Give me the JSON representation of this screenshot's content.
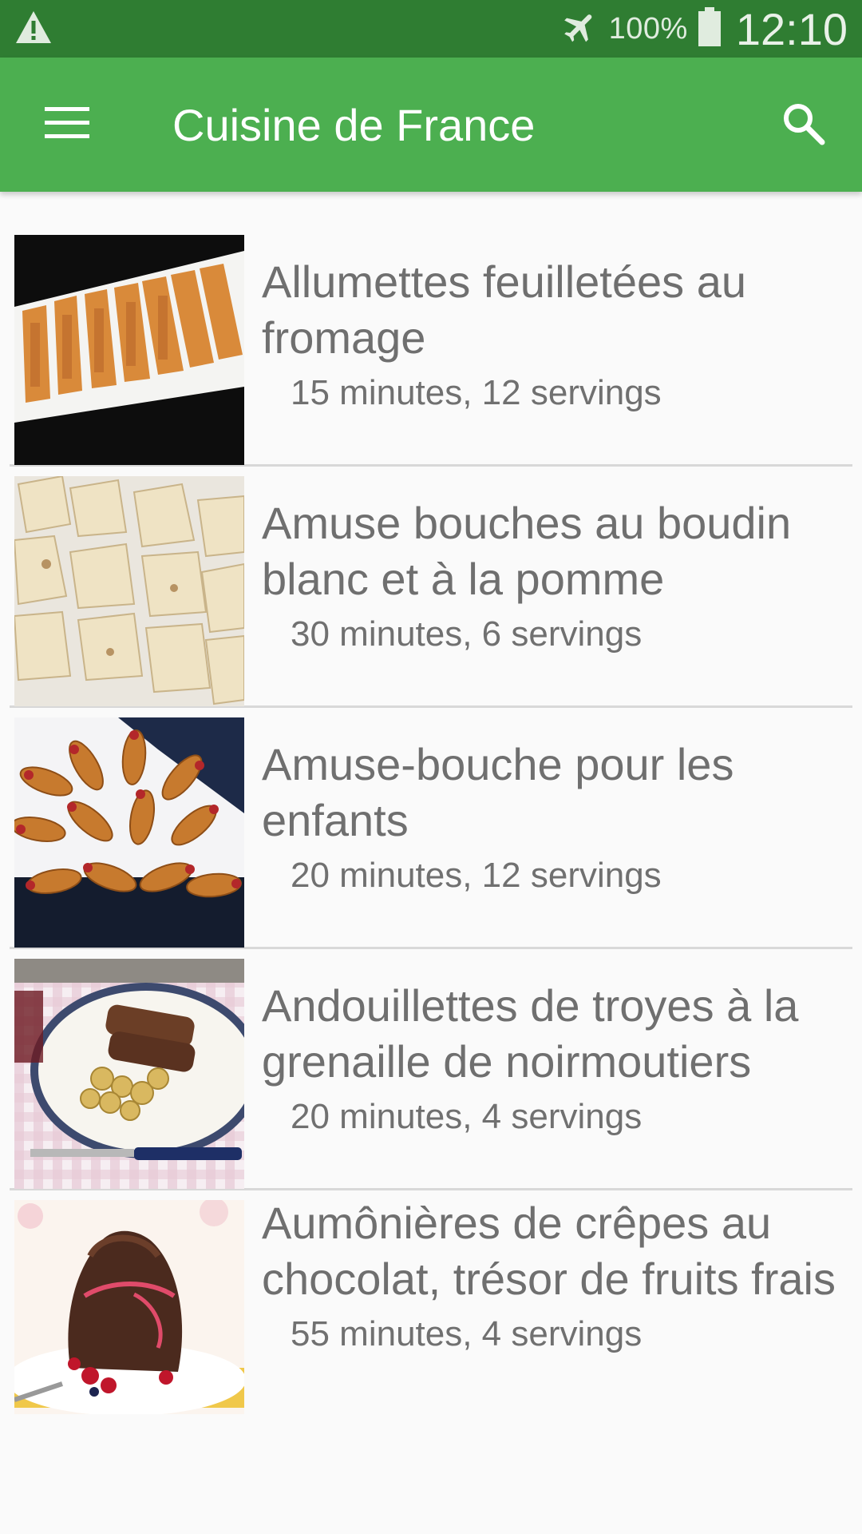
{
  "status_bar": {
    "battery": "100%",
    "time": "12:10",
    "icons": [
      "warning-icon",
      "airplane-icon",
      "battery-icon"
    ]
  },
  "app_bar": {
    "title": "Cuisine de France",
    "menu_icon": "hamburger-menu-icon",
    "search_icon": "search-icon",
    "color": "#4caf50",
    "status_color": "#2f7d32"
  },
  "recipes": [
    {
      "title": "Allumettes feuilletées au fromage",
      "meta": "15 minutes, 12 servings"
    },
    {
      "title": "Amuse bouches au boudin blanc et à la pomme",
      "meta": "30 minutes, 6 servings"
    },
    {
      "title": "Amuse-bouche pour les enfants",
      "meta": "20 minutes, 12 servings"
    },
    {
      "title": "Andouillettes de troyes à la grenaille de noirmoutiers",
      "meta": "20 minutes, 4 servings"
    },
    {
      "title": "Aumônières de crêpes au chocolat, trésor de fruits frais",
      "meta": "55 minutes, 4 servings"
    }
  ]
}
